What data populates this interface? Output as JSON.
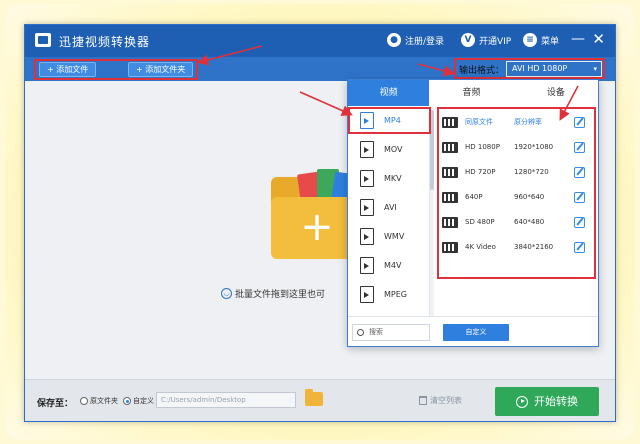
{
  "window": {
    "title": "迅捷视频转换器"
  },
  "titlebar": {
    "login_label": "注册/登录",
    "vip_label": "开通VIP",
    "menu_label": "菜单",
    "minimize": "—",
    "close": "✕"
  },
  "toolbar": {
    "add_file": "+ 添加文件",
    "add_folder": "+ 添加文件夹"
  },
  "output_format": {
    "label": "输出格式：",
    "value": "AVI  HD 1080P",
    "caret": "▾"
  },
  "drop_area": {
    "hint": "批量文件拖到这里也可",
    "plus": "+"
  },
  "format_panel": {
    "tabs": [
      {
        "label": "视频",
        "active": true
      },
      {
        "label": "音频",
        "active": false
      },
      {
        "label": "设备",
        "active": false
      }
    ],
    "formats": [
      "MP4",
      "MOV",
      "MKV",
      "AVI",
      "WMV",
      "M4V",
      "MPEG"
    ],
    "selected_format": "MP4",
    "resolutions_header": {
      "name": "同原文件",
      "size": "原分辨率"
    },
    "resolutions": [
      {
        "name": "HD 1080P",
        "size": "1920*1080"
      },
      {
        "name": "HD 720P",
        "size": "1280*720"
      },
      {
        "name": "640P",
        "size": "960*640"
      },
      {
        "name": "SD 480P",
        "size": "640*480"
      },
      {
        "name": "4K Video",
        "size": "3840*2160"
      }
    ],
    "search_placeholder": "搜索",
    "custom_label": "自定义"
  },
  "bottom": {
    "save_to": "保存至：",
    "radio_original": "原文件夹",
    "radio_custom": "自定义",
    "path": "C:/Users/admin/Desktop",
    "clear_list": "清空列表",
    "start": "开始转换"
  },
  "colors": {
    "titlebar": "#1e5fb4",
    "toolbar": "#2f73c9",
    "accent": "#2f80de",
    "start_button": "#2fa85a",
    "annotation": "#e0303a"
  }
}
